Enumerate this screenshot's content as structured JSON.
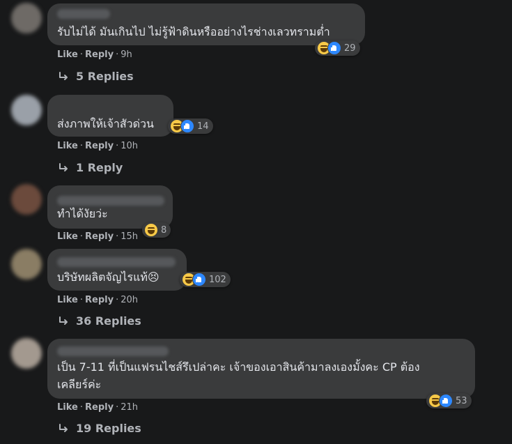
{
  "comments": [
    {
      "text": [
        "รับไม่ได้ มันเกินไป ไม่รู้ฟ้าดินหรืออย่างไรช่างเลวทรามต่ำ"
      ],
      "reaction_count": "29",
      "reactions": [
        "haha-icon",
        "like-icon"
      ],
      "like_label": "Like",
      "reply_label": "Reply",
      "time": "9h",
      "replies_label": "5 Replies"
    },
    {
      "text": [
        "ส่งภาพให้เจ้าสัวด่วน"
      ],
      "reaction_count": "14",
      "reactions": [
        "haha-icon",
        "like-icon"
      ],
      "like_label": "Like",
      "reply_label": "Reply",
      "time": "10h",
      "replies_label": "1 Reply"
    },
    {
      "text": [
        "ทำได้งัยว่ะ"
      ],
      "reaction_count": "8",
      "reactions": [
        "haha-icon"
      ],
      "like_label": "Like",
      "reply_label": "Reply",
      "time": "15h",
      "replies_label": ""
    },
    {
      "text": [
        "บริษัทผลิตจัญไรแท้😣"
      ],
      "reaction_count": "102",
      "reactions": [
        "haha-icon",
        "like-icon"
      ],
      "like_label": "Like",
      "reply_label": "Reply",
      "time": "20h",
      "replies_label": "36 Replies"
    },
    {
      "text": [
        "เป็น 7-11 ที่เป็นแฟรนไชส์รึเปล่าคะ เจ้าของเอาสินค้ามาลงเองมั้งคะ CP ต้อง",
        "เคลียร์ค่ะ"
      ],
      "reaction_count": "53",
      "reactions": [
        "haha-icon",
        "like-icon"
      ],
      "like_label": "Like",
      "reply_label": "Reply",
      "time": "21h",
      "replies_label": "19 Replies"
    }
  ],
  "separator": "·",
  "colors": {
    "background": "#18191a",
    "bubble": "#3a3b3c",
    "text": "#e4e6eb",
    "secondary": "#b0b3b8",
    "like_blue": "#2d88ff",
    "haha_yellow": "#f7c948"
  }
}
